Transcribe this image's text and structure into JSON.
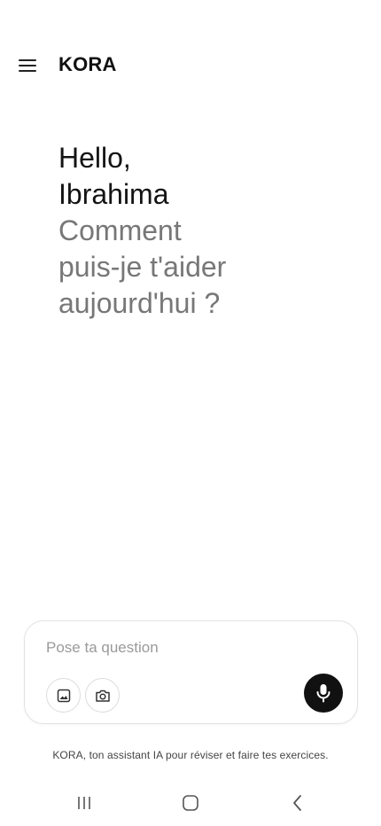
{
  "header": {
    "brand": "KORA",
    "menu_icon": "hamburger-menu-icon"
  },
  "greeting": {
    "line1": "Hello,",
    "line2": "Ibrahima",
    "line3": "Comment",
    "line4": "puis-je t'aider",
    "line5": "aujourd'hui ?"
  },
  "composer": {
    "placeholder": "Pose ta question",
    "value": "",
    "image_icon": "image-icon",
    "camera_icon": "camera-icon",
    "mic_icon": "microphone-icon"
  },
  "footer": {
    "note": "KORA, ton assistant IA pour réviser et faire tes exercices."
  },
  "system_nav": {
    "recents_icon": "recents-icon",
    "home_icon": "home-icon",
    "back_icon": "back-icon"
  },
  "colors": {
    "accent": "#111111",
    "muted_text": "#777777",
    "border": "#e2e2e2"
  }
}
